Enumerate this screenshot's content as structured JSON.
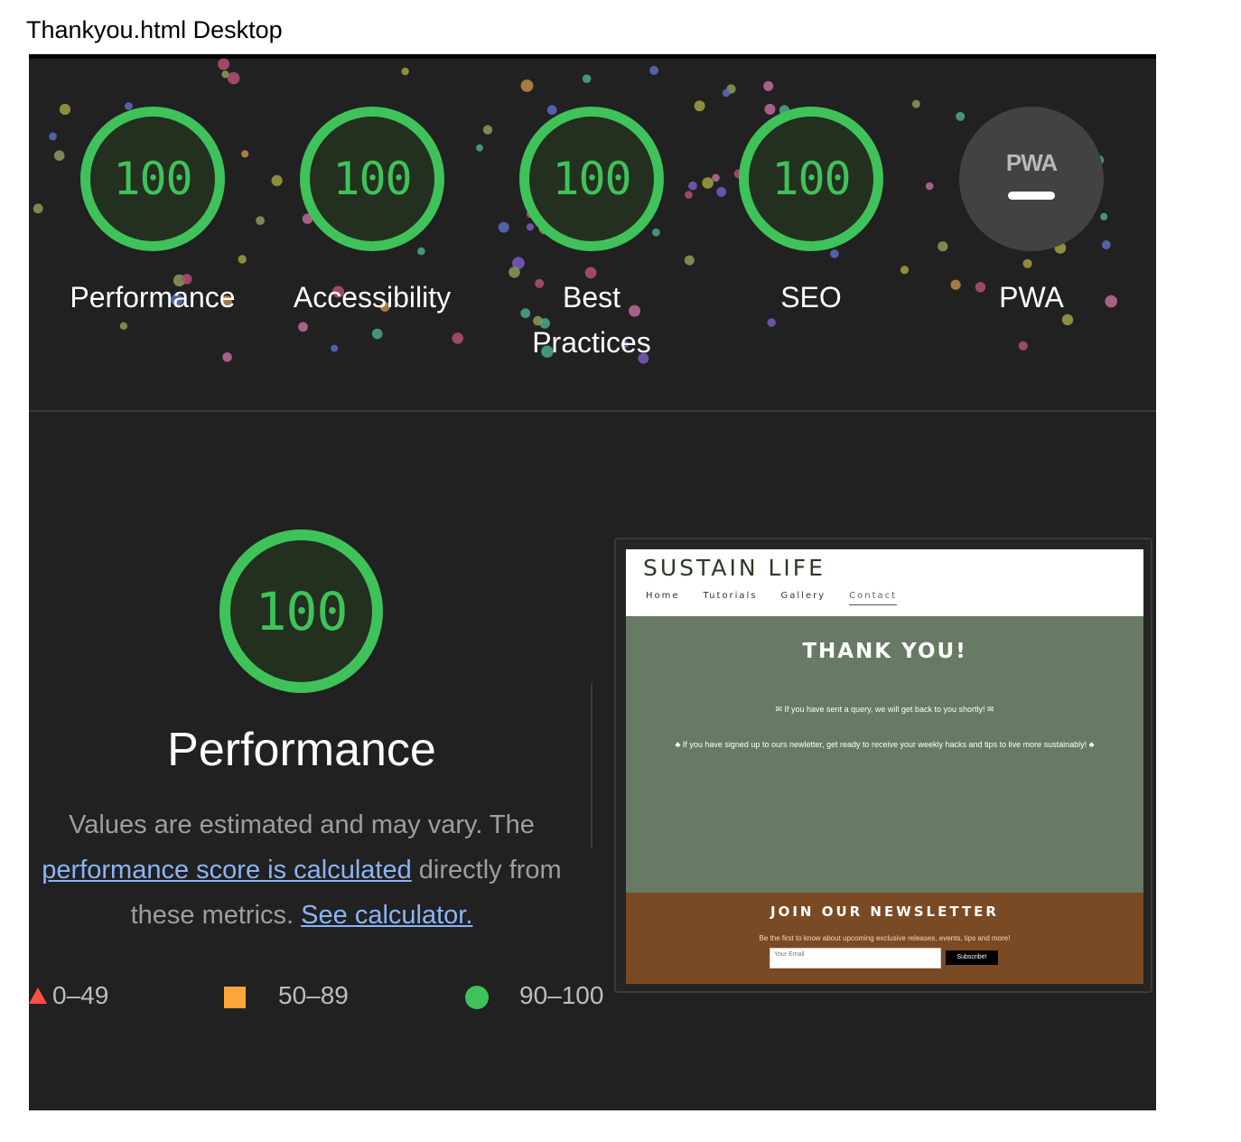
{
  "document_title": "Thankyou.html Desktop",
  "categories": [
    {
      "label_lines": [
        "Performance"
      ],
      "score": "100"
    },
    {
      "label_lines": [
        "Accessibility"
      ],
      "score": "100"
    },
    {
      "label_lines": [
        "Best",
        "Practices"
      ],
      "score": "100"
    },
    {
      "label_lines": [
        "SEO"
      ],
      "score": "100"
    },
    {
      "label_lines": [
        "PWA"
      ],
      "logo": "PWA",
      "score_shown": "—"
    }
  ],
  "performance": {
    "score": "100",
    "title": "Performance",
    "desc_part1": "Values are estimated and may vary. The ",
    "desc_link1": "performance score is calculated",
    "desc_part2": " directly from these metrics. ",
    "desc_link2": "See calculator."
  },
  "legend": {
    "fail": "0–49",
    "average": "50–89",
    "pass": "90–100"
  },
  "colors": {
    "pass": "#3fc25a",
    "average": "#ffa63b",
    "fail": "#ff4e42",
    "background": "#212121",
    "link": "#8ab4f8"
  },
  "screenshot": {
    "logo": "SUSTAIN LIFE",
    "nav": [
      "Home",
      "Tutorials",
      "Gallery",
      "Contact"
    ],
    "active_nav": "Contact",
    "heading": "THANK YOU!",
    "message1": "✉ If you have sent a query, we will get back to you shortly! ✉",
    "message2": "♣ If you have signed up to ours newletter, get ready to receive your weekly hacks and tips to live more sustainably! ♣",
    "newsletter_title": "JOIN OUR NEWSLETTER",
    "newsletter_sub": "Be the first to know about upcoming exclusive releases, events, tips and more!",
    "email_placeholder": "Your Email",
    "subscribe_label": "Subscribe!"
  }
}
